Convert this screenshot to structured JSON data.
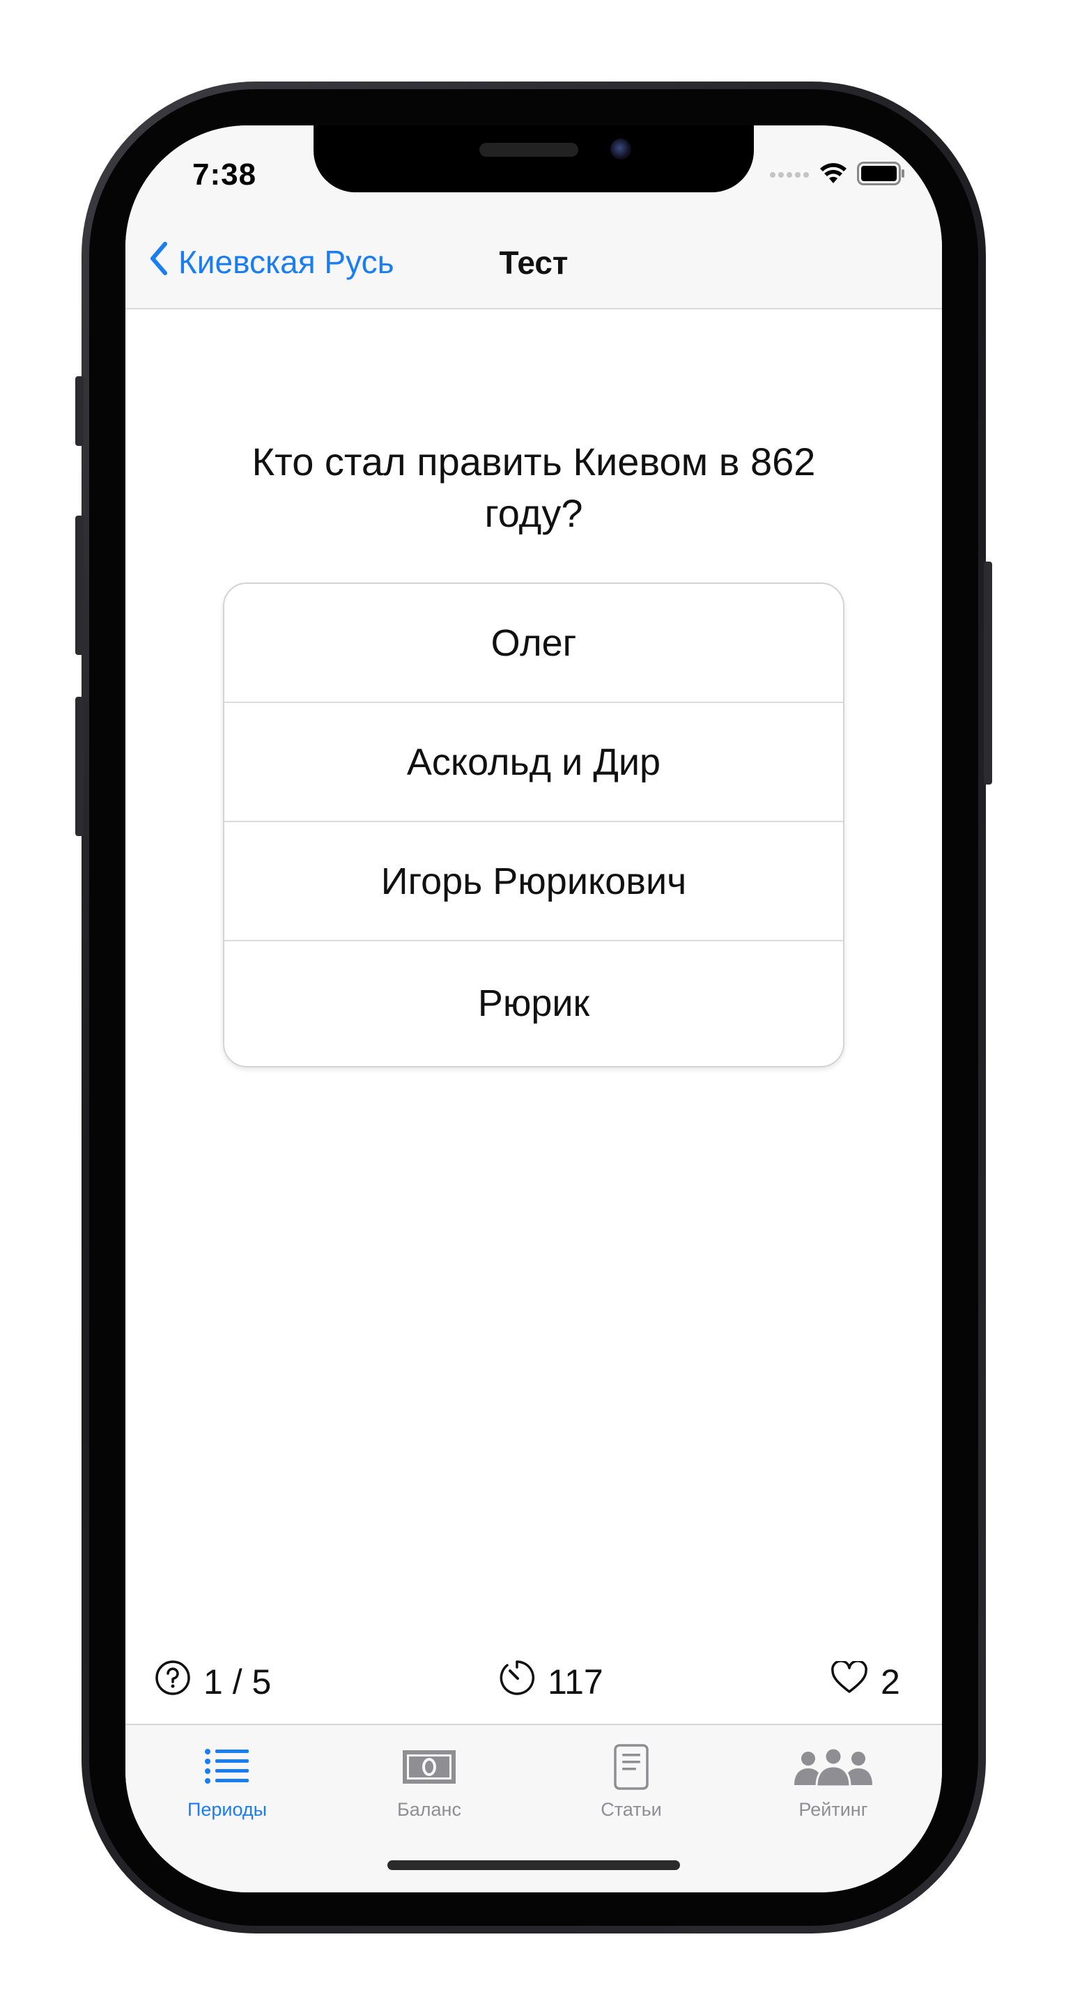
{
  "status_bar": {
    "time": "7:38"
  },
  "nav": {
    "back_label": "Киевская Русь",
    "title": "Тест"
  },
  "question": {
    "text": "Кто стал править Киевом в 862 году?"
  },
  "answers": [
    {
      "label": "Олег"
    },
    {
      "label": "Аскольд и Дир"
    },
    {
      "label": "Игорь Рюрикович"
    },
    {
      "label": "Рюрик"
    }
  ],
  "stats": {
    "progress": "1 / 5",
    "timer": "117",
    "lives": "2"
  },
  "tabbar": {
    "items": [
      {
        "label": "Периоды",
        "icon": "list-icon",
        "active": true
      },
      {
        "label": "Баланс",
        "icon": "banknote-icon",
        "active": false
      },
      {
        "label": "Статьи",
        "icon": "document-icon",
        "active": false
      },
      {
        "label": "Рейтинг",
        "icon": "people-icon",
        "active": false
      }
    ]
  },
  "colors": {
    "accent": "#1a7ef2",
    "inactive": "#8e8e93"
  }
}
